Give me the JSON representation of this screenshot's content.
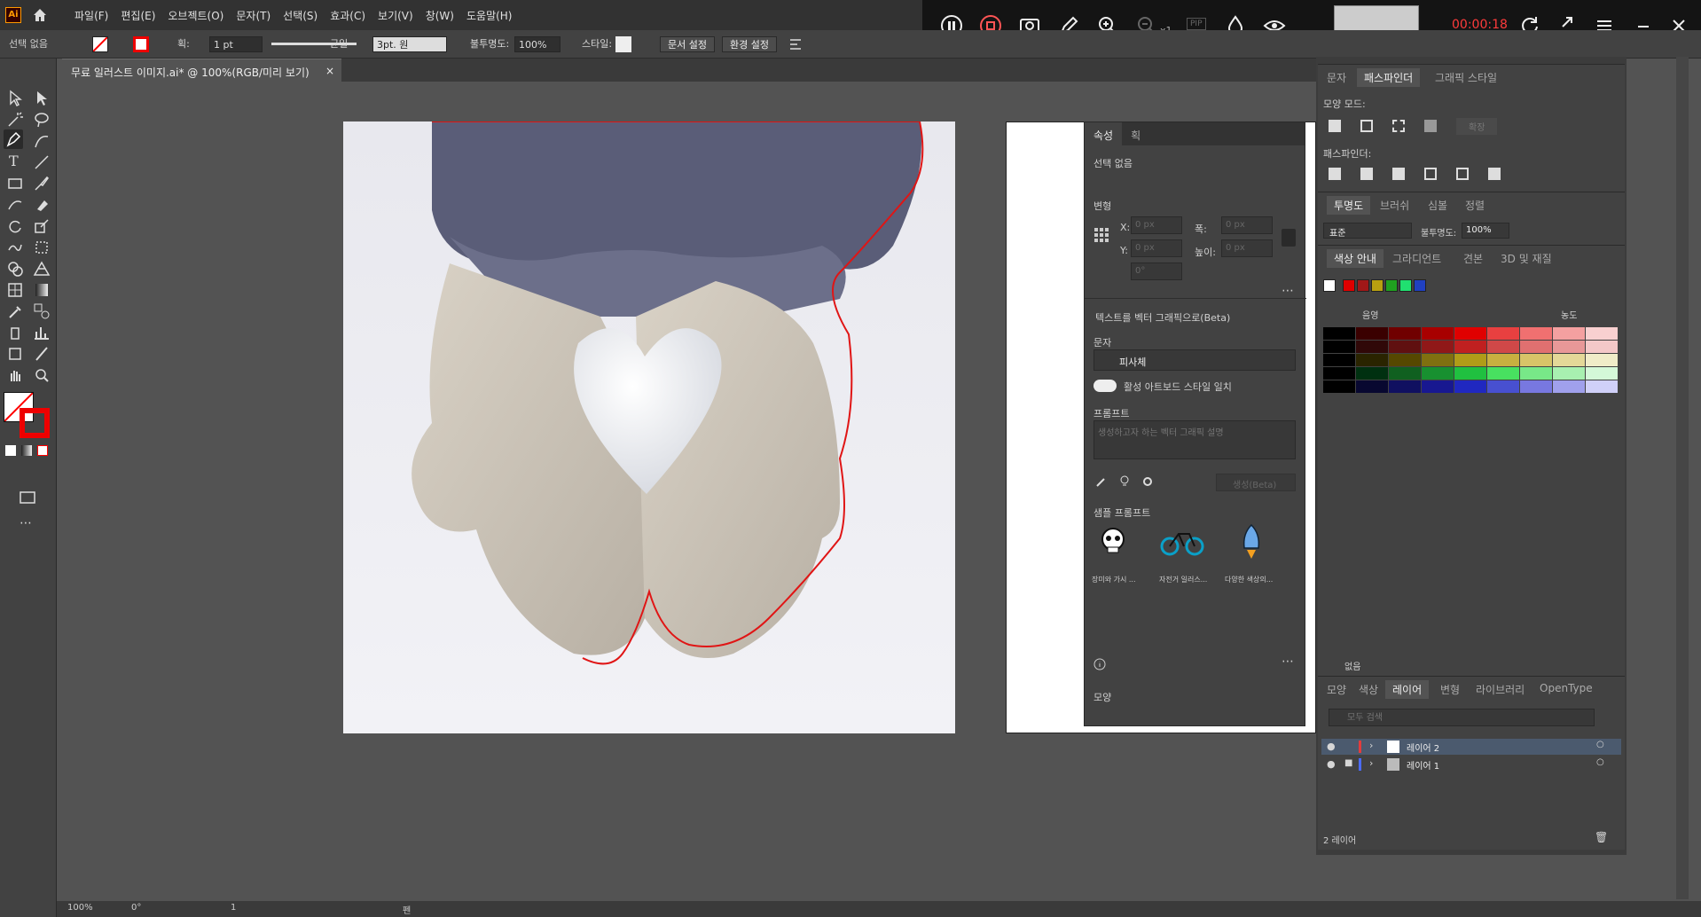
{
  "app": {
    "logo": "Ai",
    "menus": [
      "파일(F)",
      "편집(E)",
      "오브젝트(O)",
      "문자(T)",
      "선택(S)",
      "효과(C)",
      "보기(V)",
      "창(W)",
      "도움말(H)"
    ]
  },
  "recorder": {
    "time": "00:00:18",
    "zoom_suffix": "x1",
    "pip_label": "PIP"
  },
  "control": {
    "selection": "선택 없음",
    "stroke_label": "획:",
    "stroke_value": "1 pt",
    "line_style": "균일",
    "brush": "3pt. 원",
    "opacity_label": "불투명도:",
    "opacity": "100%",
    "style_label": "스타일:",
    "doc_setup": "문서 설정",
    "prefs": "환경 설정"
  },
  "doc_tab": {
    "title": "무료 일러스트 이미지.ai* @ 100%(RGB/미리 보기)",
    "close": "×"
  },
  "properties": {
    "tabs": [
      "속성",
      "획"
    ],
    "selection": "선택 없음",
    "transform_label": "변형",
    "x_label": "X:",
    "y_label": "Y:",
    "w_label": "폭:",
    "h_label": "높이:",
    "x": "0 px",
    "y": "0 px",
    "w": "0 px",
    "h": "0 px",
    "angle": "0°",
    "text_to_vector": "텍스트를 벡터 그래픽으로(Beta)",
    "type_label": "문자",
    "type_value": "피사체",
    "match_style": "활성 아트보드 스타일 일치",
    "prompt_label": "프롬프트",
    "prompt_placeholder": "생성하고자 하는 벡터 그래픽 설명",
    "generate": "생성(Beta)",
    "samples_label": "샘플 프롬프트",
    "samples": [
      "장미와 가시 ...",
      "자전거 일러스...",
      "다양한 색상의..."
    ],
    "appearance_label": "모양"
  },
  "pathfinder": {
    "tabs": [
      "문자",
      "패스파인더",
      "그래픽 스타일"
    ],
    "shape_modes": "모양 모드:",
    "expand": "확장",
    "pathfinders": "패스파인더:"
  },
  "transparency": {
    "tabs": [
      "투명도",
      "브러쉬",
      "심볼",
      "정렬"
    ],
    "mode": "표준",
    "opacity_label": "불투명도:",
    "opacity": "100%"
  },
  "color_guide": {
    "tabs": [
      "색상 안내",
      "그라디언트",
      "견본",
      "3D 및 재질"
    ],
    "shade_label": "음영",
    "tint_label": "농도",
    "none_label": "없음",
    "colors": {
      "harmony": [
        "#ffffff",
        "#e00000",
        "#a01818",
        "#b8a010",
        "#20a020",
        "#20e070",
        "#2040c0"
      ],
      "grid": [
        [
          "#000000",
          "#3a0000",
          "#700000",
          "#a80000",
          "#e00000",
          "#e84040",
          "#f07070",
          "#f4a0a0",
          "#f8d0d0"
        ],
        [
          "#000000",
          "#300808",
          "#601010",
          "#901818",
          "#c02020",
          "#d04848",
          "#e07070",
          "#e89898",
          "#f4c8c8"
        ],
        [
          "#000000",
          "#2a2400",
          "#564800",
          "#807010",
          "#b09c18",
          "#c8b040",
          "#d8c468",
          "#e4d898",
          "#f0ecc8"
        ],
        [
          "#000000",
          "#003010",
          "#106020",
          "#189030",
          "#20c040",
          "#48e060",
          "#78e888",
          "#a8f0b0",
          "#d4f8d8"
        ],
        [
          "#000000",
          "#080830",
          "#101060",
          "#181890",
          "#2028c0",
          "#4850d0",
          "#7878e0",
          "#a0a0ec",
          "#d0d0f8"
        ]
      ]
    }
  },
  "layers": {
    "tabs": [
      "모양",
      "색상",
      "레이어",
      "변형",
      "라이브러리",
      "OpenType"
    ],
    "search_placeholder": "모두 검색",
    "items": [
      {
        "name": "레이어 2",
        "color": "#e23c3c"
      },
      {
        "name": "레이어 1",
        "color": "#4b6bff"
      }
    ],
    "count": "2 레이어"
  },
  "status": {
    "zoom": "100%",
    "rotation": "0°",
    "artboard": "1",
    "tool": "펜"
  }
}
